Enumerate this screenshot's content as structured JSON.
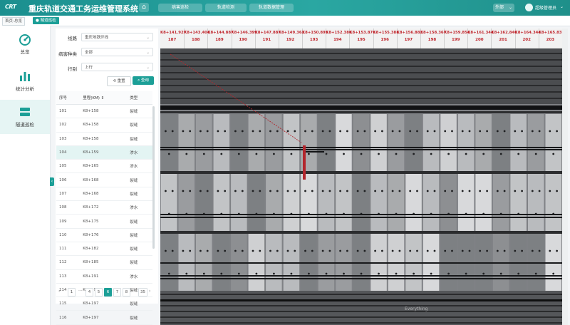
{
  "header": {
    "logo_text": "CRT",
    "title": "重庆轨道交通工务运维管理系统",
    "tabs": [
      {
        "label": "病害巡检"
      },
      {
        "label": "轨道检测"
      },
      {
        "label": "轨道数据管理"
      }
    ],
    "line_select": "外部",
    "user_name": "超级管理员"
  },
  "tabbar": {
    "crumbs": [
      {
        "label": "首页-总览"
      },
      {
        "label": "隧道巡检"
      }
    ]
  },
  "sidebar": {
    "items": [
      {
        "label": "总览",
        "icon": "dashboard-icon"
      },
      {
        "label": "统计分析",
        "icon": "bar-chart-icon"
      },
      {
        "label": "隧道巡检",
        "icon": "tunnel-icon",
        "active": true
      }
    ]
  },
  "filters": {
    "line_label": "线路",
    "line_value": "重庆地铁环线",
    "type_label": "病害种类",
    "type_value": "全部",
    "direction_label": "行别",
    "direction_value": "上行",
    "reset_label": "重置",
    "query_label": "查询"
  },
  "table": {
    "headers": [
      "序号",
      "里程(KM)",
      "类型"
    ],
    "sort_icon": "⇕",
    "rows": [
      {
        "no": "101",
        "km": "K8+158",
        "type": "裂缝"
      },
      {
        "no": "102",
        "km": "K8+158",
        "type": "裂缝"
      },
      {
        "no": "103",
        "km": "K8+158",
        "type": "裂缝"
      },
      {
        "no": "104",
        "km": "K8+159",
        "type": "渗水"
      },
      {
        "no": "105",
        "km": "K8+165",
        "type": "渗水"
      },
      {
        "no": "106",
        "km": "K8+168",
        "type": "裂缝"
      },
      {
        "no": "107",
        "km": "K8+168",
        "type": "裂缝"
      },
      {
        "no": "108",
        "km": "K8+172",
        "type": "渗水"
      },
      {
        "no": "109",
        "km": "K8+175",
        "type": "裂缝"
      },
      {
        "no": "110",
        "km": "K8+176",
        "type": "裂缝"
      },
      {
        "no": "111",
        "km": "K8+182",
        "type": "裂缝"
      },
      {
        "no": "112",
        "km": "K8+185",
        "type": "裂缝"
      },
      {
        "no": "113",
        "km": "K8+191",
        "type": "渗水"
      },
      {
        "no": "114",
        "km": "K8+197",
        "type": "裂缝"
      },
      {
        "no": "115",
        "km": "K8+197",
        "type": "裂缝"
      },
      {
        "no": "116",
        "km": "K8+197",
        "type": "裂缝"
      }
    ],
    "selected_row": "104"
  },
  "pager": {
    "prev": "‹",
    "next": "›",
    "pages": [
      "1",
      "4",
      "5",
      "6",
      "7",
      "8",
      "35"
    ],
    "ellipsis": "···",
    "active": "6"
  },
  "viewer": {
    "mileage_markers": [
      {
        "km": "K8+141.927",
        "idx": "187"
      },
      {
        "km": "K8+143.404",
        "idx": "188"
      },
      {
        "km": "K8+144.887",
        "idx": "189"
      },
      {
        "km": "K8+146.399",
        "idx": "190"
      },
      {
        "km": "K8+147.887",
        "idx": "191"
      },
      {
        "km": "K8+149.363",
        "idx": "192"
      },
      {
        "km": "K8+150.895",
        "idx": "193"
      },
      {
        "km": "K8+152.386",
        "idx": "194"
      },
      {
        "km": "K8+153.876",
        "idx": "195"
      },
      {
        "km": "K8+155.388",
        "idx": "196"
      },
      {
        "km": "K8+156.882",
        "idx": "197"
      },
      {
        "km": "K8+158.367",
        "idx": "198"
      },
      {
        "km": "K8+159.854",
        "idx": "199"
      },
      {
        "km": "K8+161.344",
        "idx": "200"
      },
      {
        "km": "K8+162.846",
        "idx": "201"
      },
      {
        "km": "K8+164.344",
        "idx": "202"
      },
      {
        "km": "K8+165.837",
        "idx": "203"
      }
    ],
    "watermark": "Everything",
    "defect_color": "#b3262d",
    "accent_color": "#1c9f97"
  }
}
